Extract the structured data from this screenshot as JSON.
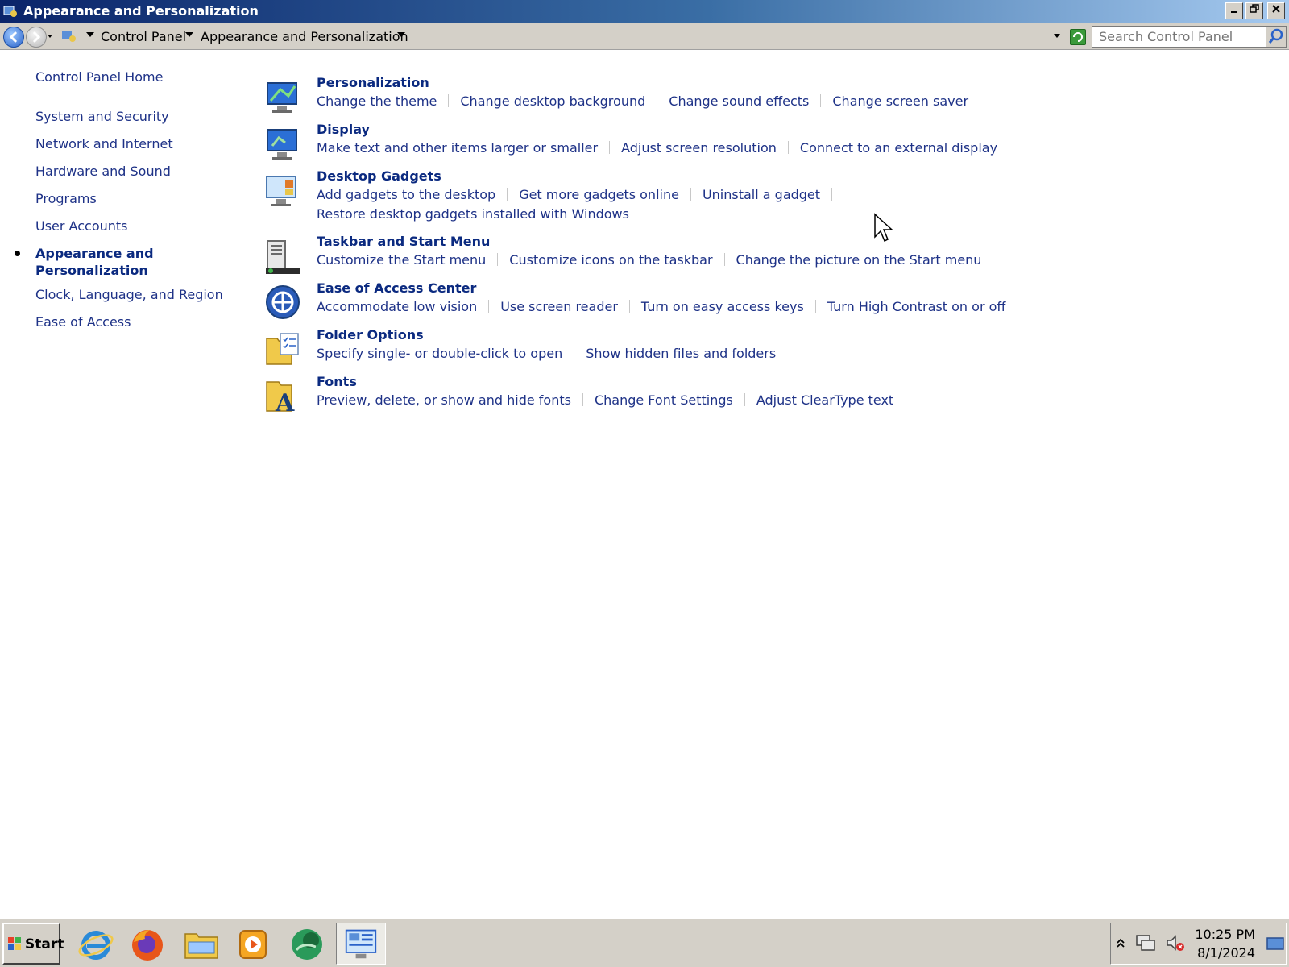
{
  "window": {
    "title": "Appearance and Personalization"
  },
  "addressbar": {
    "crumbs": [
      "Control Panel",
      "Appearance and Personalization"
    ],
    "search_placeholder": "Search Control Panel"
  },
  "sidebar": {
    "home": "Control Panel Home",
    "items": [
      "System and Security",
      "Network and Internet",
      "Hardware and Sound",
      "Programs",
      "User Accounts",
      "Appearance and Personalization",
      "Clock, Language, and Region",
      "Ease of Access"
    ],
    "current_line1": "Appearance and",
    "current_line2": "Personalization"
  },
  "sections": [
    {
      "title": "Personalization",
      "icon": "personalization-icon",
      "links": [
        "Change the theme",
        "Change desktop background",
        "Change sound effects",
        "Change screen saver"
      ]
    },
    {
      "title": "Display",
      "icon": "display-icon",
      "links": [
        "Make text and other items larger or smaller",
        "Adjust screen resolution",
        "Connect to an external display"
      ]
    },
    {
      "title": "Desktop Gadgets",
      "icon": "gadgets-icon",
      "links": [
        "Add gadgets to the desktop",
        "Get more gadgets online",
        "Uninstall a gadget",
        "Restore desktop gadgets installed with Windows"
      ]
    },
    {
      "title": "Taskbar and Start Menu",
      "icon": "taskbar-icon",
      "links": [
        "Customize the Start menu",
        "Customize icons on the taskbar",
        "Change the picture on the Start menu"
      ]
    },
    {
      "title": "Ease of Access Center",
      "icon": "ease-of-access-icon",
      "links": [
        "Accommodate low vision",
        "Use screen reader",
        "Turn on easy access keys",
        "Turn High Contrast on or off"
      ]
    },
    {
      "title": "Folder Options",
      "icon": "folder-options-icon",
      "links": [
        "Specify single- or double-click to open",
        "Show hidden files and folders"
      ]
    },
    {
      "title": "Fonts",
      "icon": "fonts-icon",
      "links": [
        "Preview, delete, or show and hide fonts",
        "Change Font Settings",
        "Adjust ClearType text"
      ]
    }
  ],
  "taskbar": {
    "start_label": "Start",
    "apps": [
      "internet-explorer-icon",
      "firefox-icon",
      "file-explorer-icon",
      "media-player-icon",
      "messenger-icon",
      "control-panel-icon"
    ],
    "time": "10:25 PM",
    "date": "8/1/2024"
  },
  "colors": {
    "link": "#1e3287",
    "heading": "#0b2a80",
    "titlebar_start": "#0a246a",
    "titlebar_end": "#a6caf0",
    "chrome": "#d4d0c8"
  }
}
